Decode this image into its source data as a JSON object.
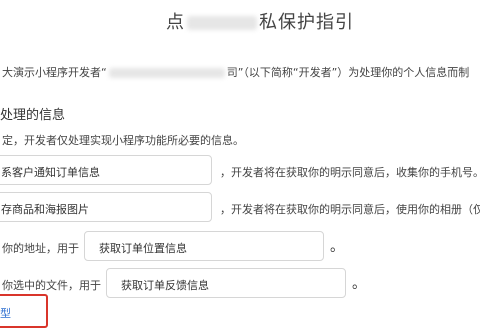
{
  "page": {
    "title_prefix": "点",
    "title_suffix": "私保护指引",
    "intro_prefix": "大演示小程序开发者“",
    "intro_suffix": "司”（以下简称“开发者”）为处理你的个人信息而制",
    "section_heading": "处理的信息",
    "note": "定，开发者仅处理实现小程序功能所必要的信息。"
  },
  "items": [
    {
      "field_value": "系客户通知订单信息",
      "after_text": "，开发者将在获取你的明示同意后，收集你的手机号。"
    },
    {
      "field_value": "存商品和海报图片",
      "after_text": "，开发者将在获取你的明示同意后，使用你的相册（仅"
    },
    {
      "before_text": "你的地址，用于",
      "field_value": "获取订单位置信息",
      "after_text": "。"
    },
    {
      "before_text": "你选中的文件，用于",
      "field_value": "获取订单反馈信息",
      "after_text": "。"
    }
  ],
  "footer": {
    "link_text": "型"
  }
}
